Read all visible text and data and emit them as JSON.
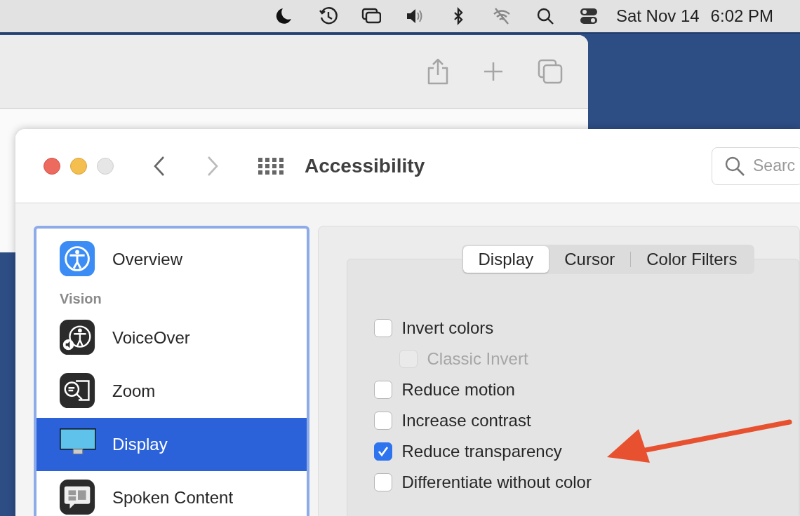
{
  "menu_bar": {
    "date": "Sat Nov 14",
    "time": "6:02 PM"
  },
  "window": {
    "title": "Accessibility",
    "search": {
      "placeholder": "Searc"
    }
  },
  "sidebar": {
    "items": [
      {
        "kind": "item",
        "label": "Overview",
        "selected": false
      },
      {
        "kind": "header",
        "label": "Vision"
      },
      {
        "kind": "item",
        "label": "VoiceOver",
        "selected": false
      },
      {
        "kind": "item",
        "label": "Zoom",
        "selected": false
      },
      {
        "kind": "item",
        "label": "Display",
        "selected": true
      },
      {
        "kind": "item",
        "label": "Spoken Content",
        "selected": false
      }
    ]
  },
  "tabs": [
    {
      "label": "Display",
      "selected": true
    },
    {
      "label": "Cursor",
      "selected": false
    },
    {
      "label": "Color Filters",
      "selected": false
    }
  ],
  "options": [
    {
      "label": "Invert colors",
      "checked": false,
      "disabled": false,
      "children": [
        {
          "label": "Classic Invert",
          "checked": false,
          "disabled": true
        }
      ]
    },
    {
      "label": "Reduce motion",
      "checked": false,
      "disabled": false
    },
    {
      "label": "Increase contrast",
      "checked": false,
      "disabled": false
    },
    {
      "label": "Reduce transparency",
      "checked": true,
      "disabled": false
    },
    {
      "label": "Differentiate without color",
      "checked": false,
      "disabled": false
    }
  ]
}
